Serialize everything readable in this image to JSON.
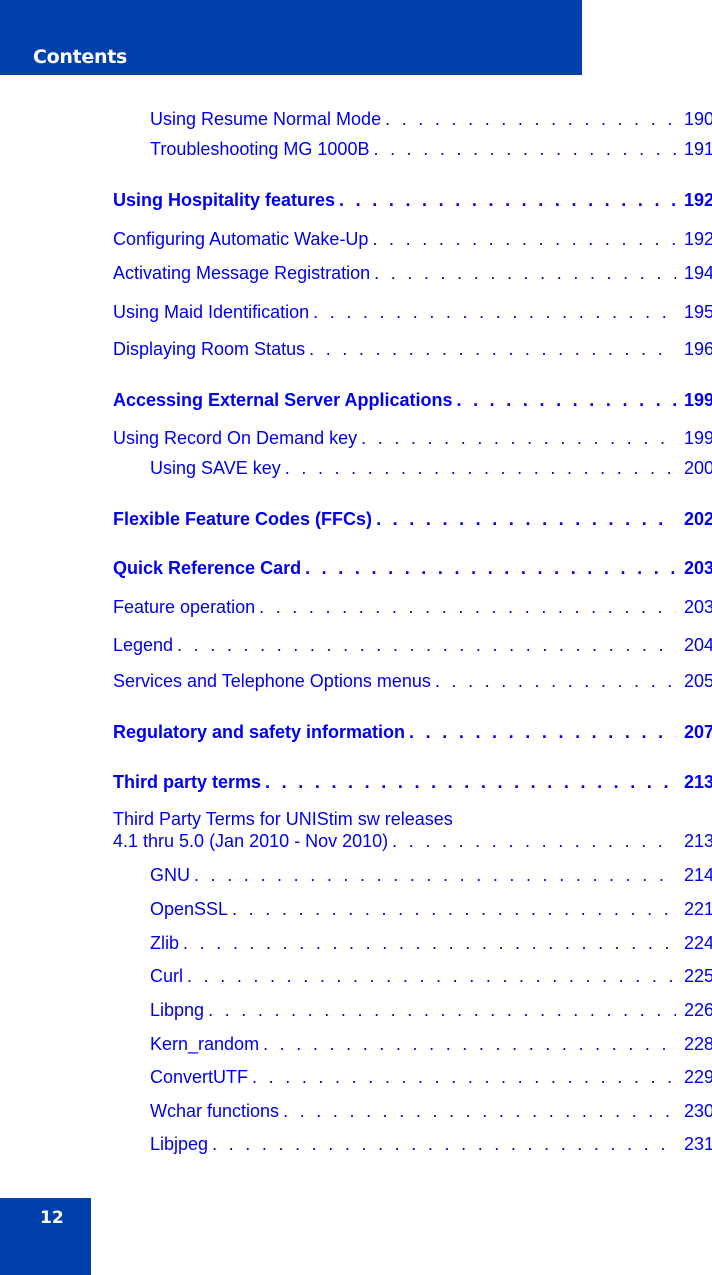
{
  "header": {
    "title": "Contents",
    "color": "#0040ac"
  },
  "page_number": "12",
  "toc": [
    {
      "title": "Using Resume Normal Mode",
      "page": "190",
      "level": 2,
      "bold": false
    },
    {
      "title": "Troubleshooting MG 1000B",
      "page": "191",
      "level": 2,
      "bold": false
    },
    {
      "title": "Using Hospitality features",
      "page": "192",
      "level": 1,
      "bold": true
    },
    {
      "title": "Configuring Automatic Wake-Up",
      "page": "192",
      "level": 1,
      "bold": false
    },
    {
      "title": "Activating Message Registration",
      "page": "194",
      "level": 1,
      "bold": false
    },
    {
      "title": "Using Maid Identification",
      "page": "195",
      "level": 1,
      "bold": false
    },
    {
      "title": "Displaying Room Status",
      "page": "196",
      "level": 1,
      "bold": false
    },
    {
      "title": "Accessing External Server Applications",
      "page": "199",
      "level": 1,
      "bold": true
    },
    {
      "title": "Using Record On Demand key",
      "page": "199",
      "level": 1,
      "bold": false
    },
    {
      "title": "Using SAVE key",
      "page": "200",
      "level": 2,
      "bold": false
    },
    {
      "title": "Flexible Feature Codes (FFCs)",
      "page": "202",
      "level": 1,
      "bold": true
    },
    {
      "title": "Quick Reference Card",
      "page": "203",
      "level": 1,
      "bold": true
    },
    {
      "title": "Feature operation",
      "page": "203",
      "level": 1,
      "bold": false
    },
    {
      "title": "Legend",
      "page": "204",
      "level": 1,
      "bold": false
    },
    {
      "title": "Services and Telephone Options menus",
      "page": "205",
      "level": 1,
      "bold": false
    },
    {
      "title": "Regulatory and safety information",
      "page": "207",
      "level": 1,
      "bold": true
    },
    {
      "title": "Third party terms",
      "page": "213",
      "level": 1,
      "bold": true
    },
    {
      "title_line1": "Third Party Terms for UNIStim sw releases",
      "title": "4.1 thru 5.0 (Jan 2010 - Nov 2010)",
      "page": "213",
      "level": 1,
      "bold": false
    },
    {
      "title": "GNU",
      "page": "214",
      "level": 2,
      "bold": false
    },
    {
      "title": "OpenSSL",
      "page": "221",
      "level": 2,
      "bold": false
    },
    {
      "title": "Zlib",
      "page": "224",
      "level": 2,
      "bold": false
    },
    {
      "title": "Curl",
      "page": "225",
      "level": 2,
      "bold": false
    },
    {
      "title": "Libpng",
      "page": "226",
      "level": 2,
      "bold": false
    },
    {
      "title": "Kern_random",
      "page": "228",
      "level": 2,
      "bold": false
    },
    {
      "title": "ConvertUTF",
      "page": "229",
      "level": 2,
      "bold": false
    },
    {
      "title": "Wchar functions",
      "page": "230",
      "level": 2,
      "bold": false
    },
    {
      "title": "Libjpeg",
      "page": "231",
      "level": 2,
      "bold": false
    }
  ]
}
